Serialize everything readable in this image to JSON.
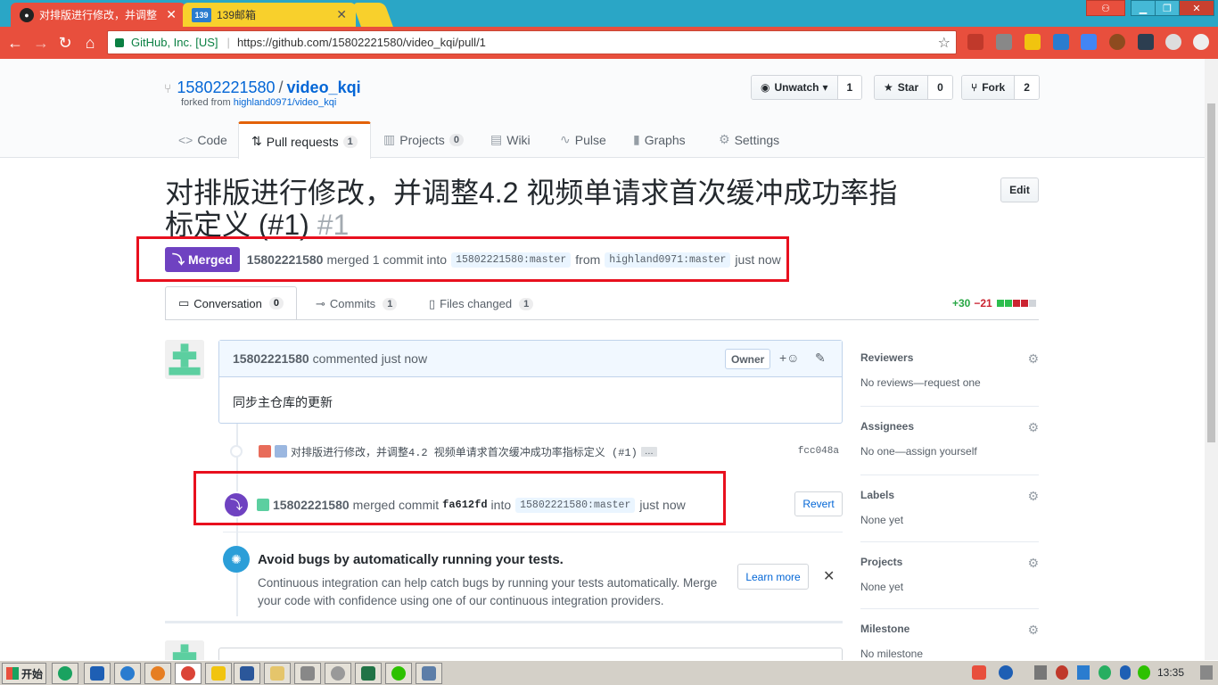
{
  "browser": {
    "tabs": [
      {
        "title": "对排版进行修改，并调整",
        "active": true
      },
      {
        "title": "139邮箱",
        "favicon_text": "139",
        "active": false
      }
    ],
    "omnibox": {
      "cert": "GitHub, Inc. [US]",
      "url": "https://github.com/15802221580/video_kqi/pull/1"
    },
    "icons": {
      "back": "back-icon",
      "forward": "forward-icon",
      "reload": "reload-icon",
      "home": "home-icon"
    }
  },
  "repo": {
    "owner": "15802221580",
    "name": "video_kqi",
    "forked_label": "forked from",
    "forked_from": "highland0971/video_kqi",
    "unwatch": {
      "label": "Unwatch",
      "count": "1"
    },
    "star": {
      "label": "Star",
      "count": "0"
    },
    "fork": {
      "label": "Fork",
      "count": "2"
    },
    "tabs": [
      {
        "label": "Code"
      },
      {
        "label": "Pull requests",
        "count": "1"
      },
      {
        "label": "Projects",
        "count": "0"
      },
      {
        "label": "Wiki"
      },
      {
        "label": "Pulse"
      },
      {
        "label": "Graphs"
      },
      {
        "label": "Settings"
      }
    ]
  },
  "pr": {
    "title": "对排版进行修改，并调整4.2 视频单请求首次缓冲成功率指标定义 (#1)",
    "number": "#1",
    "edit_label": "Edit",
    "state": "Merged",
    "author": "15802221580",
    "merged_text": "merged 1 commit into",
    "base_branch": "15802221580:master",
    "from_text": "from",
    "head_branch": "highland0971:master",
    "time": "just now",
    "tabs": [
      {
        "label": "Conversation",
        "count": "0"
      },
      {
        "label": "Commits",
        "count": "1"
      },
      {
        "label": "Files changed",
        "count": "1"
      }
    ],
    "diffstat": {
      "additions": "+30",
      "deletions": "−21"
    }
  },
  "comment": {
    "author": "15802221580",
    "action": "commented just now",
    "owner_badge": "Owner",
    "body": "同步主仓库的更新"
  },
  "commit": {
    "message": "对排版进行修改，并调整4.2 视频单请求首次缓冲成功率指标定义 (#1)",
    "more": "…",
    "sha": "fcc048a"
  },
  "merge_event": {
    "author": "15802221580",
    "text": "merged commit",
    "sha": "fa612fd",
    "into": "into",
    "branch": "15802221580:master",
    "time": "just now",
    "revert_label": "Revert"
  },
  "ci": {
    "title": "Avoid bugs by automatically running your tests.",
    "body": "Continuous integration can help catch bugs by running your tests automatically. Merge your code with confidence using one of our continuous integration providers.",
    "learn_more": "Learn more"
  },
  "sidebar": [
    {
      "heading": "Reviewers",
      "value": "No reviews—request one"
    },
    {
      "heading": "Assignees",
      "value": "No one—assign yourself"
    },
    {
      "heading": "Labels",
      "value": "None yet"
    },
    {
      "heading": "Projects",
      "value": "None yet"
    },
    {
      "heading": "Milestone",
      "value": "No milestone"
    }
  ],
  "taskbar": {
    "start": "开始",
    "clock": "13:35"
  },
  "colors": {
    "merged": "#6f42c1",
    "highlight_box": "#e8101e",
    "chrome_red": "#e84f3d",
    "tabbar": "#2aa6c6"
  }
}
